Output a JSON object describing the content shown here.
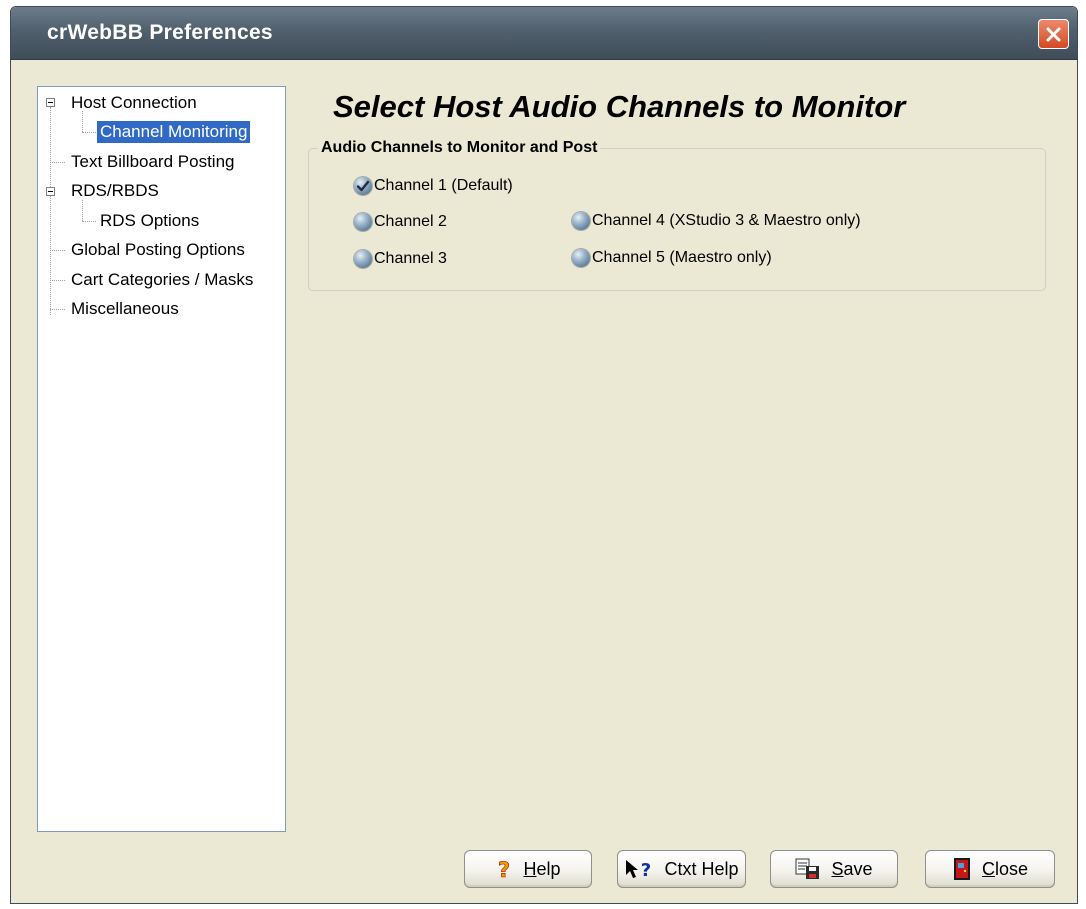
{
  "window": {
    "title": "crWebBB Preferences"
  },
  "tree": {
    "items": [
      {
        "label": "Host Connection"
      },
      {
        "label": "Channel Monitoring"
      },
      {
        "label": "Text Billboard Posting"
      },
      {
        "label": "RDS/RBDS"
      },
      {
        "label": "RDS Options"
      },
      {
        "label": "Global Posting Options"
      },
      {
        "label": "Cart Categories / Masks"
      },
      {
        "label": "Miscellaneous"
      }
    ],
    "selected": "Channel Monitoring"
  },
  "panel": {
    "heading": "Select Host Audio Channels to Monitor",
    "group_label": "Audio Channels to Monitor and Post",
    "channels": [
      {
        "label": "Channel 1 (Default)",
        "checked": true
      },
      {
        "label": "Channel 2",
        "checked": false
      },
      {
        "label": "Channel 3",
        "checked": false
      },
      {
        "label": "Channel 4 (XStudio 3 & Maestro only)",
        "checked": false
      },
      {
        "label": "Channel 5 (Maestro only)",
        "checked": false
      }
    ]
  },
  "buttons": {
    "help": {
      "mnemonic": "H",
      "rest": "elp",
      "icon": "question-icon"
    },
    "ctxt_help": {
      "label": "Ctxt Help",
      "icon": "context-help-icon"
    },
    "save": {
      "mnemonic": "S",
      "rest": "ave",
      "icon": "save-icon"
    },
    "close": {
      "mnemonic": "C",
      "rest": "lose",
      "icon": "door-exit-icon"
    }
  },
  "colors": {
    "dialog_bg": "#ebe8d4",
    "titlebar": "#51606d",
    "selection": "#316ac5",
    "close_button": "#d24a24"
  }
}
